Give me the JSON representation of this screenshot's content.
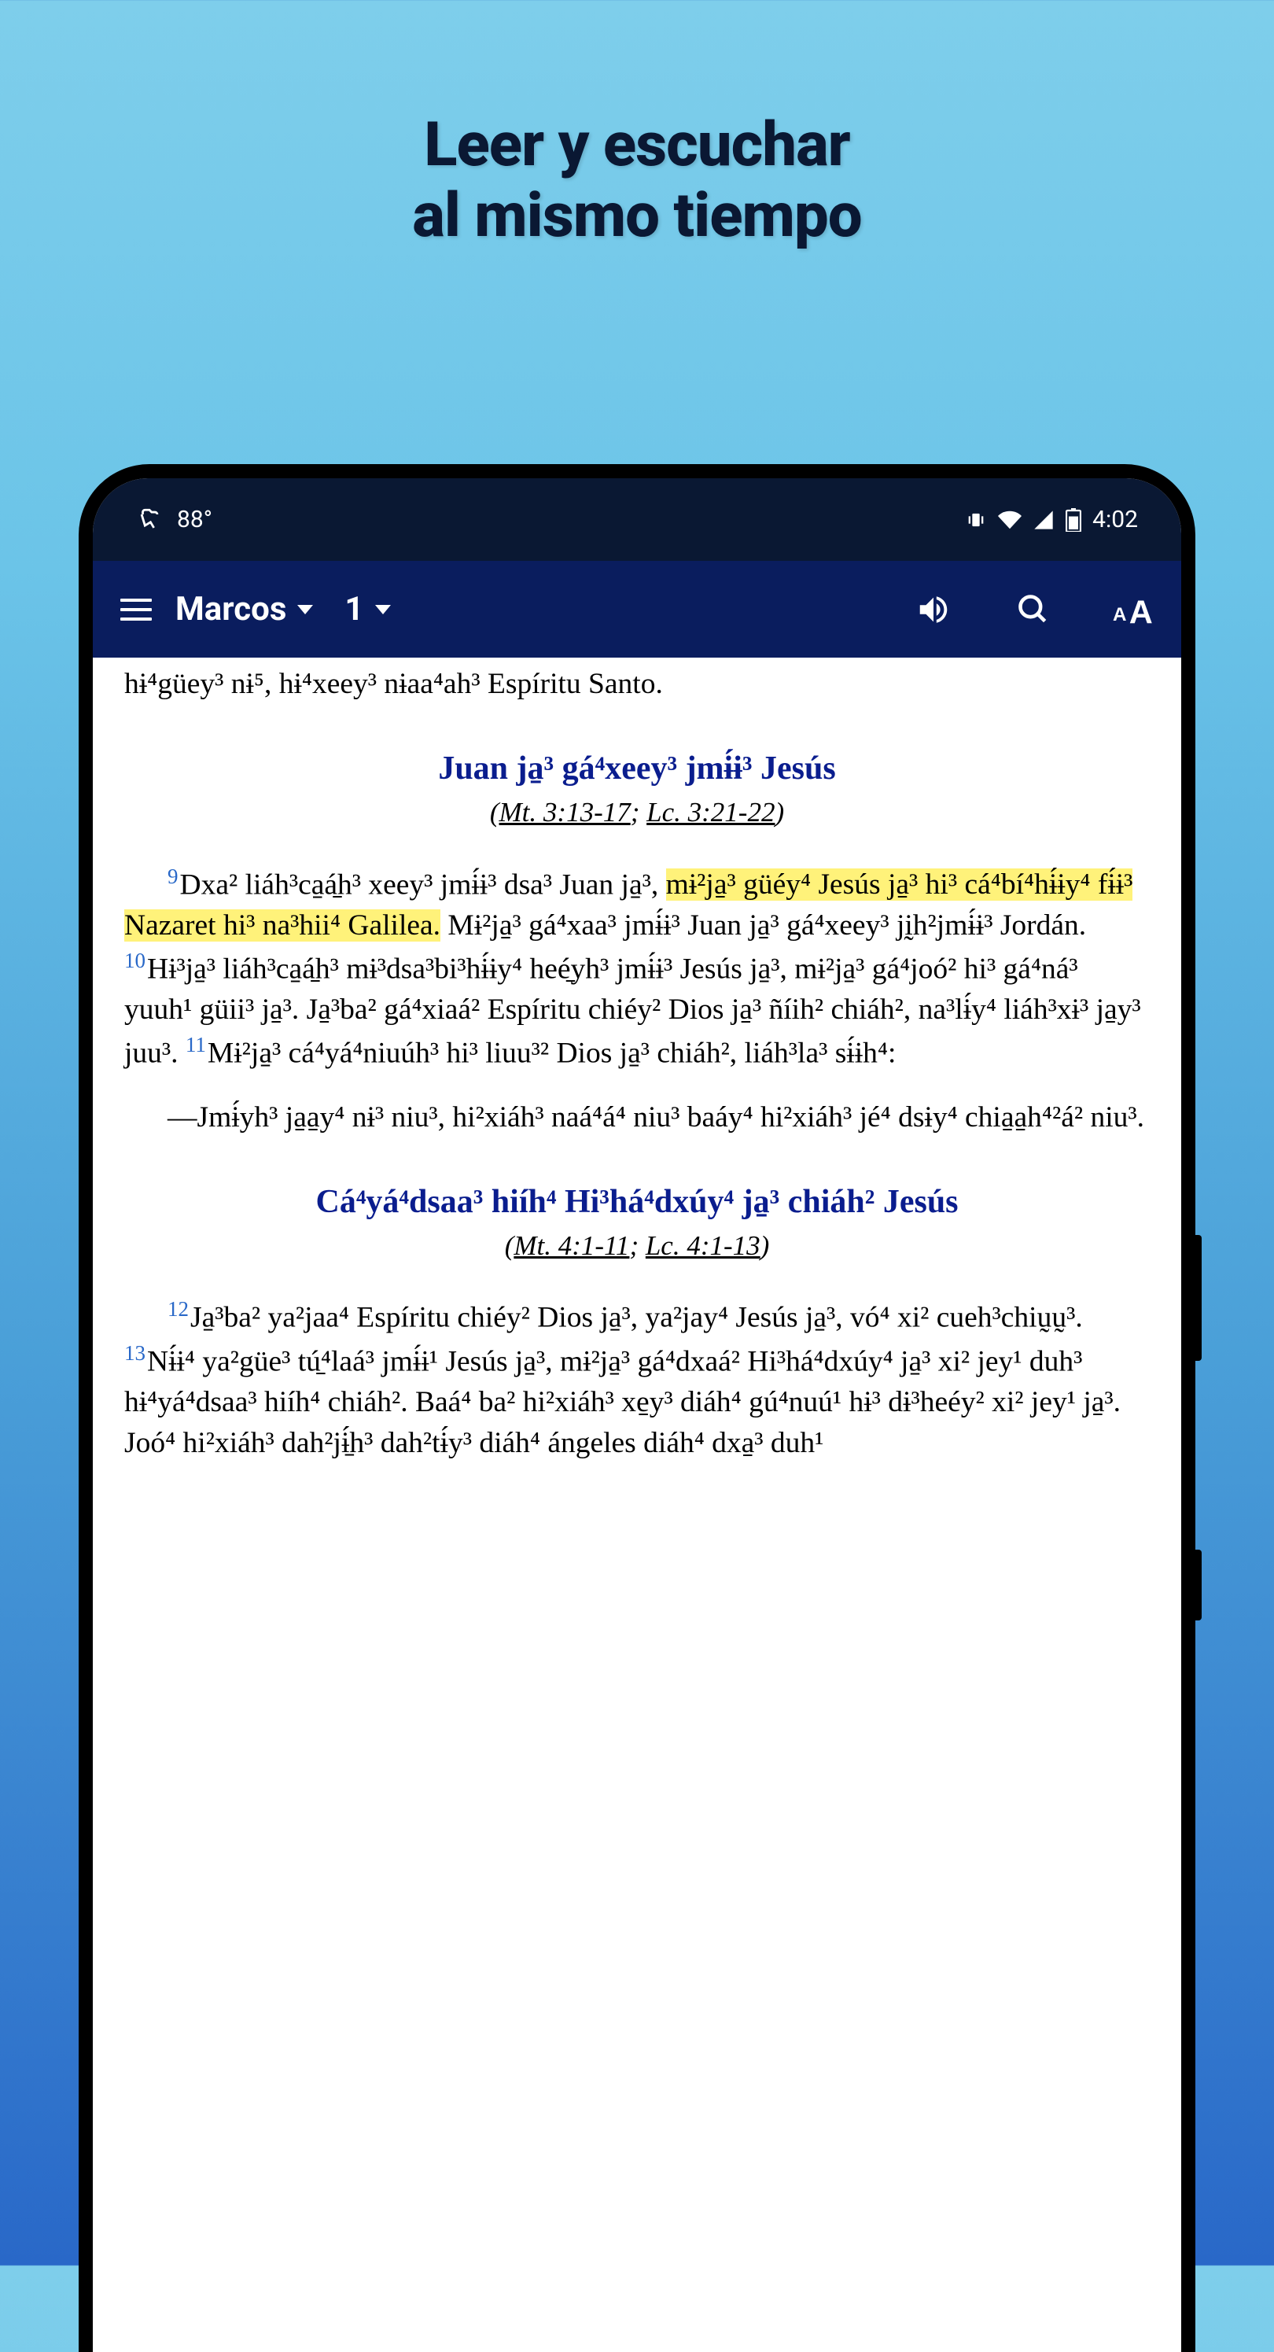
{
  "promo": {
    "line1": "Leer y escuchar",
    "line2": "al mismo tiempo"
  },
  "status": {
    "temp": "88°",
    "time": "4:02"
  },
  "appbar": {
    "book": "Marcos",
    "chapter": "1"
  },
  "truncated": "hɨ⁴güey³ nɨ⁵, hɨ⁴xeey³ nɨaa⁴ah³ Espíritu Santo.",
  "section1": {
    "heading": "Juan ja̱³ gá⁴xeey³ jmɨ́ɨ³ Jesús",
    "ref1": "Mt. 3:13-17",
    "ref2": "Lc. 3:21-22",
    "v9num": "9",
    "v9a": "Dxa² liáh³ca̱á̱h³ xeey³ jmɨ́ɨ³ dsa³ Juan ja̱³, ",
    "v9hl": "mɨ²ja̱³ güéy⁴ Jesús ja̱³ hi³ cá⁴bí⁴hɨ́ɨy⁴ fɨ́ɨ³ Nazaret hi³ na³hii⁴ Galilea.",
    "v9b": " Mɨ²ja̱³ gá⁴xaa³ jmɨ́ɨ³ Juan ja̱³ gá⁴xeey³ jḭh²jmɨ́ɨ³ Jordán. ",
    "v10num": "10",
    "v10": "Hɨ³ja̱³ liáh³ca̱á̱h³ mɨ³dsa³bi³hɨ́ɨy⁴ heé̱yh³ jmɨ́ɨ³ Jesús ja̱³, mɨ²ja̱³ gá⁴joó² hi³ gá⁴ná³ yuuh¹ güii³ ja̱³. Ja̱³ba² gá⁴xiaá² Espíritu chiéy² Dios ja̱³ ñíih² chiáh², na³lɨ́y⁴ liáh³xɨ³ ja̱y³ juu³. ",
    "v11num": "11",
    "v11": "Mɨ²ja̱³ cá⁴yá⁴niuúh³ hi³ liuu³² Dios ja̱³ chiáh², liáh³la³ sɨ́ɨh⁴:",
    "quote": "—Jmɨ́yh³ ja̱a̱y⁴ nɨ³ niu³, hi²xiáh³ naá⁴á⁴ niu³ baáy⁴ hi²xiáh³ jé⁴ dsɨy⁴ chia̱a̱h⁴²á² niu³."
  },
  "section2": {
    "heading": "Cá⁴yá⁴dsaa³ hiíh⁴ Hi³há⁴dxúy⁴ ja̱³ chiáh² Jesús",
    "ref1": "Mt. 4:1-11",
    "ref2": "Lc. 4:1-13",
    "v12num": "12",
    "v12": "Ja̱³ba² ya²jaa⁴ Espíritu chiéy² Dios ja̱³, ya²jay⁴ Jesús ja̱³, vó⁴ xi² cueh³chiṵṵ³. ",
    "v13num": "13",
    "v13": "Nɨ́ɨ⁴ ya²güe³ tú̱⁴laá³ jmɨ́ɨ¹ Jesús ja̱³, mɨ²ja̱³ gá⁴dxaá² Hi³há⁴dxúy⁴ ja̱³ xi² jey¹ duh³ hɨ⁴yá⁴dsaa³ hiíh⁴ chiáh². Baá⁴ ba² hi²xiáh³ xe̱y³ diáh⁴ gú⁴nuú¹ hɨ³ dɨ³heéy² xi² jey¹ ja̱³. Joó⁴ hi²xiáh³ dah²jɨ̱́h³ dah²tɨ́y³ diáh⁴ ángeles diáh⁴ dxa̱³ duh¹"
  }
}
